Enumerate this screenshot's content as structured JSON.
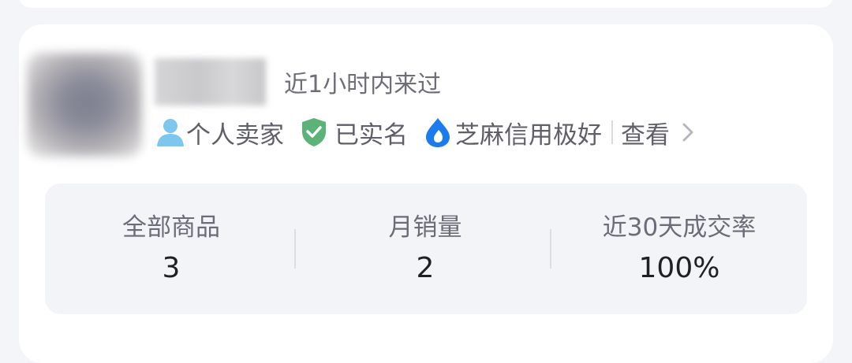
{
  "seller": {
    "last_active": "近1小时内来过",
    "tags": {
      "personal_seller": "个人卖家",
      "verified": "已实名",
      "sesame_credit": "芝麻信用极好",
      "view": "查看"
    }
  },
  "stats": {
    "items": [
      {
        "label": "全部商品",
        "value": "3"
      },
      {
        "label": "月销量",
        "value": "2"
      },
      {
        "label": "近30天成交率",
        "value": "100%"
      }
    ]
  },
  "colors": {
    "person_icon": "#7cc6f0",
    "shield_icon": "#5cb377",
    "sesame_icon": "#1a7cf0",
    "text_secondary": "#6e6e77",
    "text_primary": "#1f1f24",
    "panel_bg": "#f3f4f8"
  },
  "icons": [
    "person-icon",
    "shield-check-icon",
    "sesame-credit-icon",
    "chevron-right-icon"
  ]
}
